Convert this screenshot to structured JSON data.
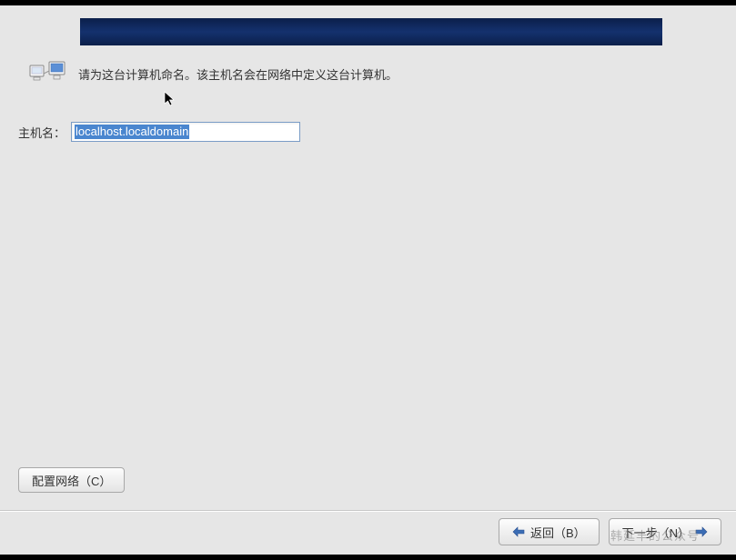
{
  "instruction": {
    "text": "请为这台计算机命名。该主机名会在网络中定义这台计算机。"
  },
  "form": {
    "hostname_label": "主机名：",
    "hostname_value": "localhost.localdomain"
  },
  "buttons": {
    "configure_network": "配置网络（C）",
    "back": "返回（B）",
    "next": "下一步（N）"
  },
  "watermark": "韩延丰的公众号"
}
